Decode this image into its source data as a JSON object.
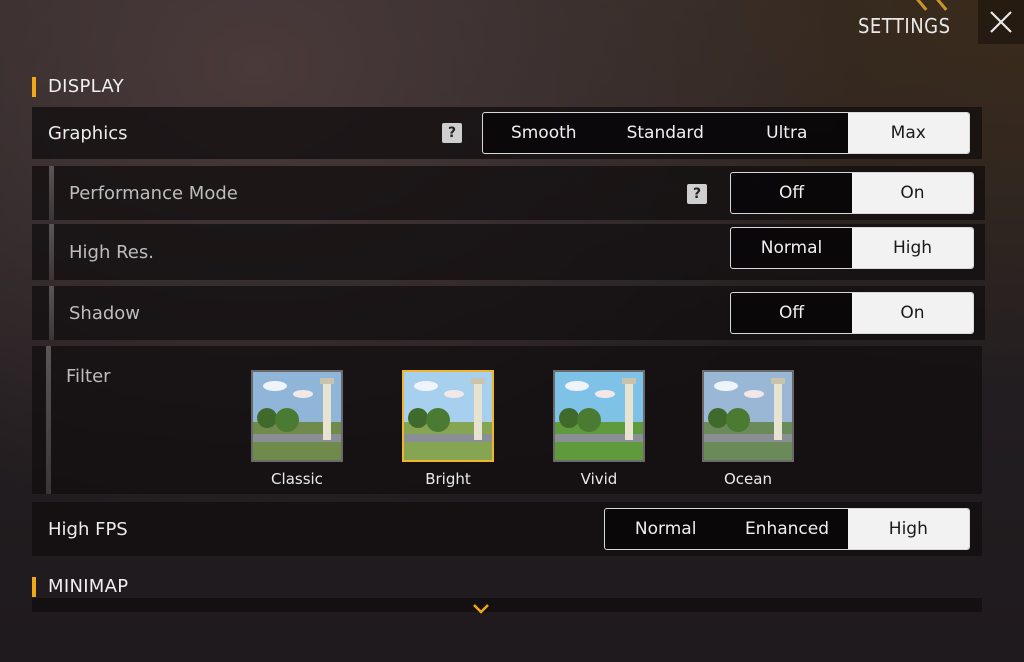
{
  "header": {
    "title": "SETTINGS"
  },
  "sections": {
    "display": "DISPLAY",
    "minimap": "MINIMAP"
  },
  "graphics": {
    "label": "Graphics",
    "help": "?",
    "options": [
      "Smooth",
      "Standard",
      "Ultra",
      "Max"
    ],
    "selected": "Max",
    "recommended_icon": "thumbs-up-icon"
  },
  "performance_mode": {
    "label": "Performance Mode",
    "help": "?",
    "options": [
      "Off",
      "On"
    ],
    "selected": "On"
  },
  "high_res": {
    "label": "High Res.",
    "options": [
      "Normal",
      "High"
    ],
    "selected": "High"
  },
  "shadow": {
    "label": "Shadow",
    "options": [
      "Off",
      "On"
    ],
    "selected": "On"
  },
  "filter": {
    "label": "Filter",
    "options": [
      "Classic",
      "Bright",
      "Vivid",
      "Ocean"
    ],
    "selected": "Bright"
  },
  "high_fps": {
    "label": "High FPS",
    "options": [
      "Normal",
      "Enhanced",
      "High"
    ],
    "selected": "High"
  },
  "colors": {
    "accent": "#f0a817",
    "selected_bg": "#f2f2f2",
    "filter_selected_border": "#f0b62a"
  }
}
